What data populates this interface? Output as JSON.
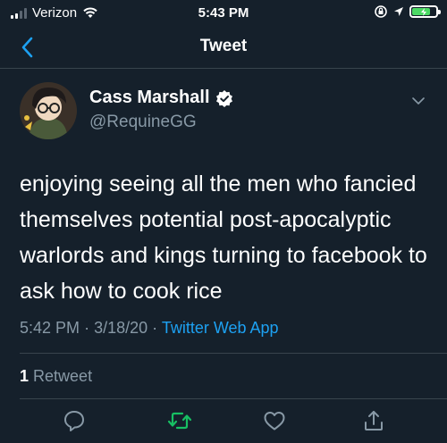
{
  "status_bar": {
    "carrier": "Verizon",
    "time": "5:43 PM",
    "signal_bars_active": 2,
    "battery_color": "#4cd964"
  },
  "nav": {
    "title": "Tweet",
    "back_icon": "chevron-left-icon"
  },
  "tweet": {
    "author_name": "Cass Marshall",
    "verified": true,
    "handle": "@RequineGG",
    "text": "enjoying seeing all the men who fancied themselves potential post-apocalyptic warlords and kings turning to facebook to ask how to cook rice",
    "time": "5:42 PM",
    "date": "3/18/20",
    "separator": "·",
    "source": "Twitter Web App",
    "retweet_count": "1",
    "retweet_label": "Retweet"
  },
  "actions": [
    "reply-icon",
    "retweet-icon",
    "like-icon",
    "share-icon"
  ],
  "colors": {
    "background": "#15202b",
    "accent": "#1da1f2",
    "secondary_text": "#8899a6",
    "divider": "#38444d",
    "retweet_green": "#17bf63"
  }
}
